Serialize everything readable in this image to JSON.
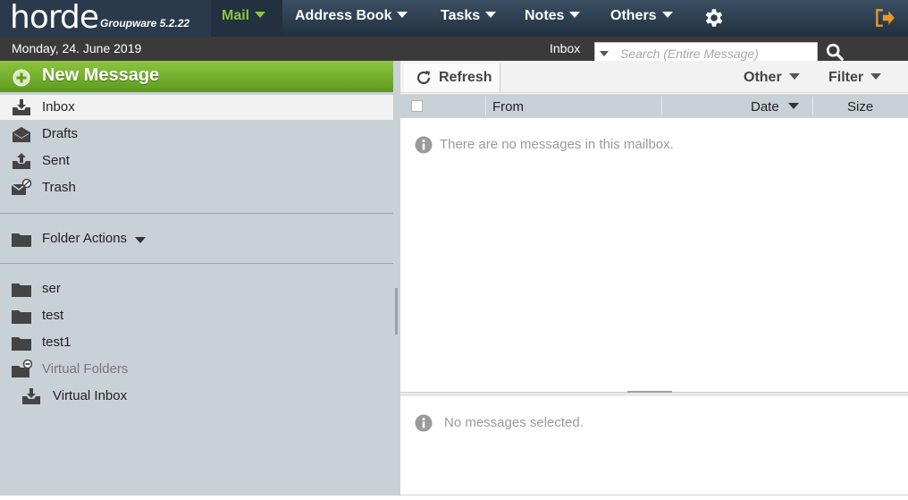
{
  "app": {
    "logo_word": "horde",
    "logo_sub": "Groupware 5.2.22"
  },
  "nav": {
    "mail": "Mail",
    "address_book": "Address Book",
    "tasks": "Tasks",
    "notes": "Notes",
    "others": "Others"
  },
  "subbar": {
    "date": "Monday, 24. June 2019",
    "mailbox": "Inbox",
    "search_placeholder": "Search (Entire Message)"
  },
  "sidebar": {
    "new_message": "New Message",
    "mailboxes": [
      {
        "label": "Inbox",
        "icon": "inbox-icon"
      },
      {
        "label": "Drafts",
        "icon": "drafts-icon"
      },
      {
        "label": "Sent",
        "icon": "sent-icon"
      },
      {
        "label": "Trash",
        "icon": "trash-icon"
      }
    ],
    "folder_actions": "Folder Actions",
    "folders": [
      {
        "label": "ser"
      },
      {
        "label": "test"
      },
      {
        "label": "test1"
      }
    ],
    "virtual_folders": "Virtual Folders",
    "virtual_inbox": "Virtual Inbox"
  },
  "toolbar": {
    "refresh": "Refresh",
    "other": "Other",
    "filter": "Filter"
  },
  "columns": {
    "from": "From",
    "date": "Date",
    "size": "Size"
  },
  "messages": {
    "empty": "There are no messages in this mailbox.",
    "none_selected": "No messages selected."
  },
  "colors": {
    "accent_green": "#8cc63f",
    "topbar": "#2a3a4c",
    "sidebar_bg": "#c8d1d6",
    "logout_orange": "#e8962c"
  }
}
